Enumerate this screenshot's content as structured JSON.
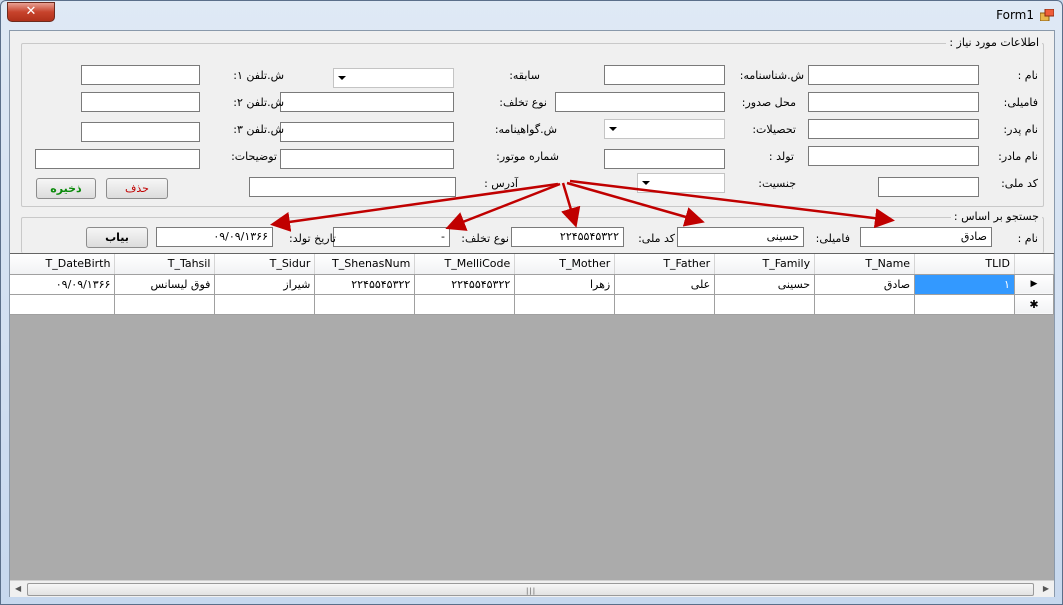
{
  "window": {
    "title": "Form1",
    "close_label": "✕"
  },
  "info_group": {
    "legend": "اطلاعات مورد نیاز :",
    "labels": {
      "name": "نام :",
      "family": "فامیلی:",
      "father": "نام پدر:",
      "mother": "نام مادر:",
      "mellicode": "کد ملی:",
      "shenas": "ش.شناسنامه:",
      "sidur": "محل صدور:",
      "tahsil": "تحصیلات:",
      "birth": "تولد :",
      "gender": "جنسیت:",
      "sabeghe": "سابقه:",
      "takhalof": "نوع تخلف:",
      "govahi": "ش.گواهینامه:",
      "motor": "شماره موتور:",
      "address": "آدرس :",
      "tel1": "ش.تلفن ۱:",
      "tel2": "ش.تلفن ۲:",
      "tel3": "ش.تلفن ۳:",
      "desc": "توضیحات:"
    },
    "delete_label": "حذف",
    "save_label": "ذخیره"
  },
  "search_group": {
    "legend": "جستجو بر اساس :",
    "name_label": "نام :",
    "name_value": "صادق",
    "family_label": "فامیلی:",
    "family_value": "حسینی",
    "mellicode_label": "کد ملی:",
    "mellicode_value": "۲۲۴۵۵۴۵۳۲۲",
    "takhalof_label": "نوع تخلف:",
    "takhalof_value": "-",
    "birth_label": "تاریخ تولد:",
    "birth_value": "۰۹/۰۹/۱۳۶۶",
    "find_label": "بیاب"
  },
  "grid": {
    "columns": [
      "TLID",
      "T_Name",
      "T_Family",
      "T_Father",
      "T_Mother",
      "T_MelliCode",
      "T_ShenasNum",
      "T_Sidur",
      "T_Tahsil",
      "T_DateBirth"
    ],
    "rows": [
      [
        "۱",
        "صادق",
        "حسینی",
        "علی",
        "زهرا",
        "۲۲۴۵۵۴۵۳۲۲",
        "۲۲۴۵۵۴۵۳۲۲",
        "شیراز",
        "فوق لیسانس",
        "۰۹/۰۹/۱۳۶۶"
      ]
    ],
    "current_row_marker": "▶",
    "new_row_marker": "✱"
  },
  "colors": {
    "selection": "#3399ff",
    "arrow": "#c00000"
  }
}
